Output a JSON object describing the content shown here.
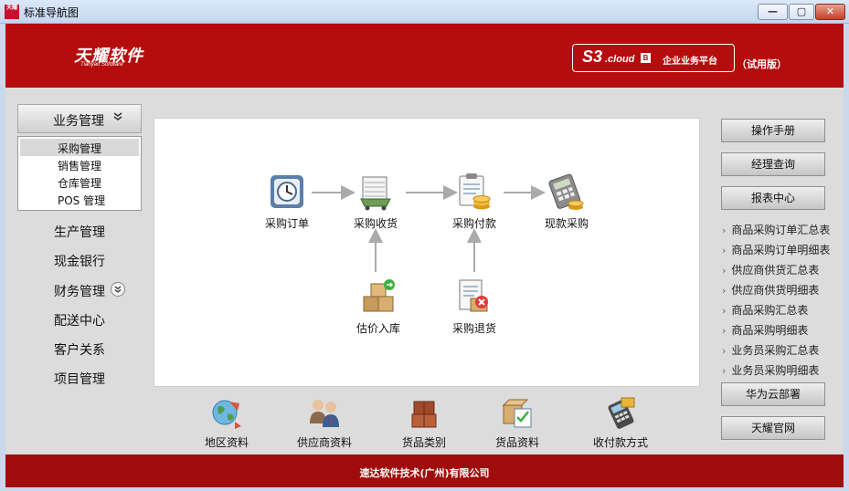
{
  "window": {
    "title": "标准导航图",
    "app_icon_text": "天耀",
    "minimize_glyph": "—",
    "maximize_glyph": "▢",
    "close_glyph": "✕"
  },
  "header": {
    "logo_cn": "天耀软件",
    "logo_en": "Tianyao Software",
    "product": "S3",
    "cloud": ".cloud",
    "badge": "B",
    "platform": "企业业务平台",
    "edition": "（试用版）",
    "brand_color": "#b50d0d"
  },
  "sidebar": {
    "active_category": "业务管理",
    "active_chevron": "»",
    "sub_items": [
      "采购管理",
      "销售管理",
      "仓库管理",
      "POS 管理"
    ],
    "selected_sub": "采购管理",
    "categories": [
      "生产管理",
      "现金银行",
      "财务管理",
      "配送中心",
      "客户关系",
      "项目管理"
    ],
    "finance_chevron": "»"
  },
  "flow": {
    "nodes": [
      {
        "label": "采购订单",
        "icon": "clock-calendar-icon"
      },
      {
        "label": "采购收货",
        "icon": "shopping-cart-icon"
      },
      {
        "label": "采购付款",
        "icon": "clipboard-coins-icon"
      },
      {
        "label": "现款采购",
        "icon": "calculator-coins-icon"
      },
      {
        "label": "估价入库",
        "icon": "boxes-stock-icon"
      },
      {
        "label": "采购退货",
        "icon": "return-document-icon"
      }
    ]
  },
  "bottom_links": [
    {
      "label": "地区资料",
      "icon": "globe-region-icon"
    },
    {
      "label": "供应商资料",
      "icon": "suppliers-people-icon"
    },
    {
      "label": "货品类别",
      "icon": "category-boxes-icon"
    },
    {
      "label": "货品资料",
      "icon": "product-box-icon"
    },
    {
      "label": "收付款方式",
      "icon": "payment-terminal-icon"
    }
  ],
  "right_panel": {
    "manual": "操作手册",
    "manager_query": "经理查询",
    "report_center": "报表中心",
    "reports": [
      "商品采购订单汇总表",
      "商品采购订单明细表",
      "供应商供货汇总表",
      "供应商供货明细表",
      "商品采购汇总表",
      "商品采购明细表",
      "业务员采购汇总表",
      "业务员采购明细表"
    ],
    "report_arrow": "›",
    "huawei": "华为云部署",
    "official_site": "天耀官网"
  },
  "footer": {
    "company": "速达软件技术(广州)有限公司"
  }
}
